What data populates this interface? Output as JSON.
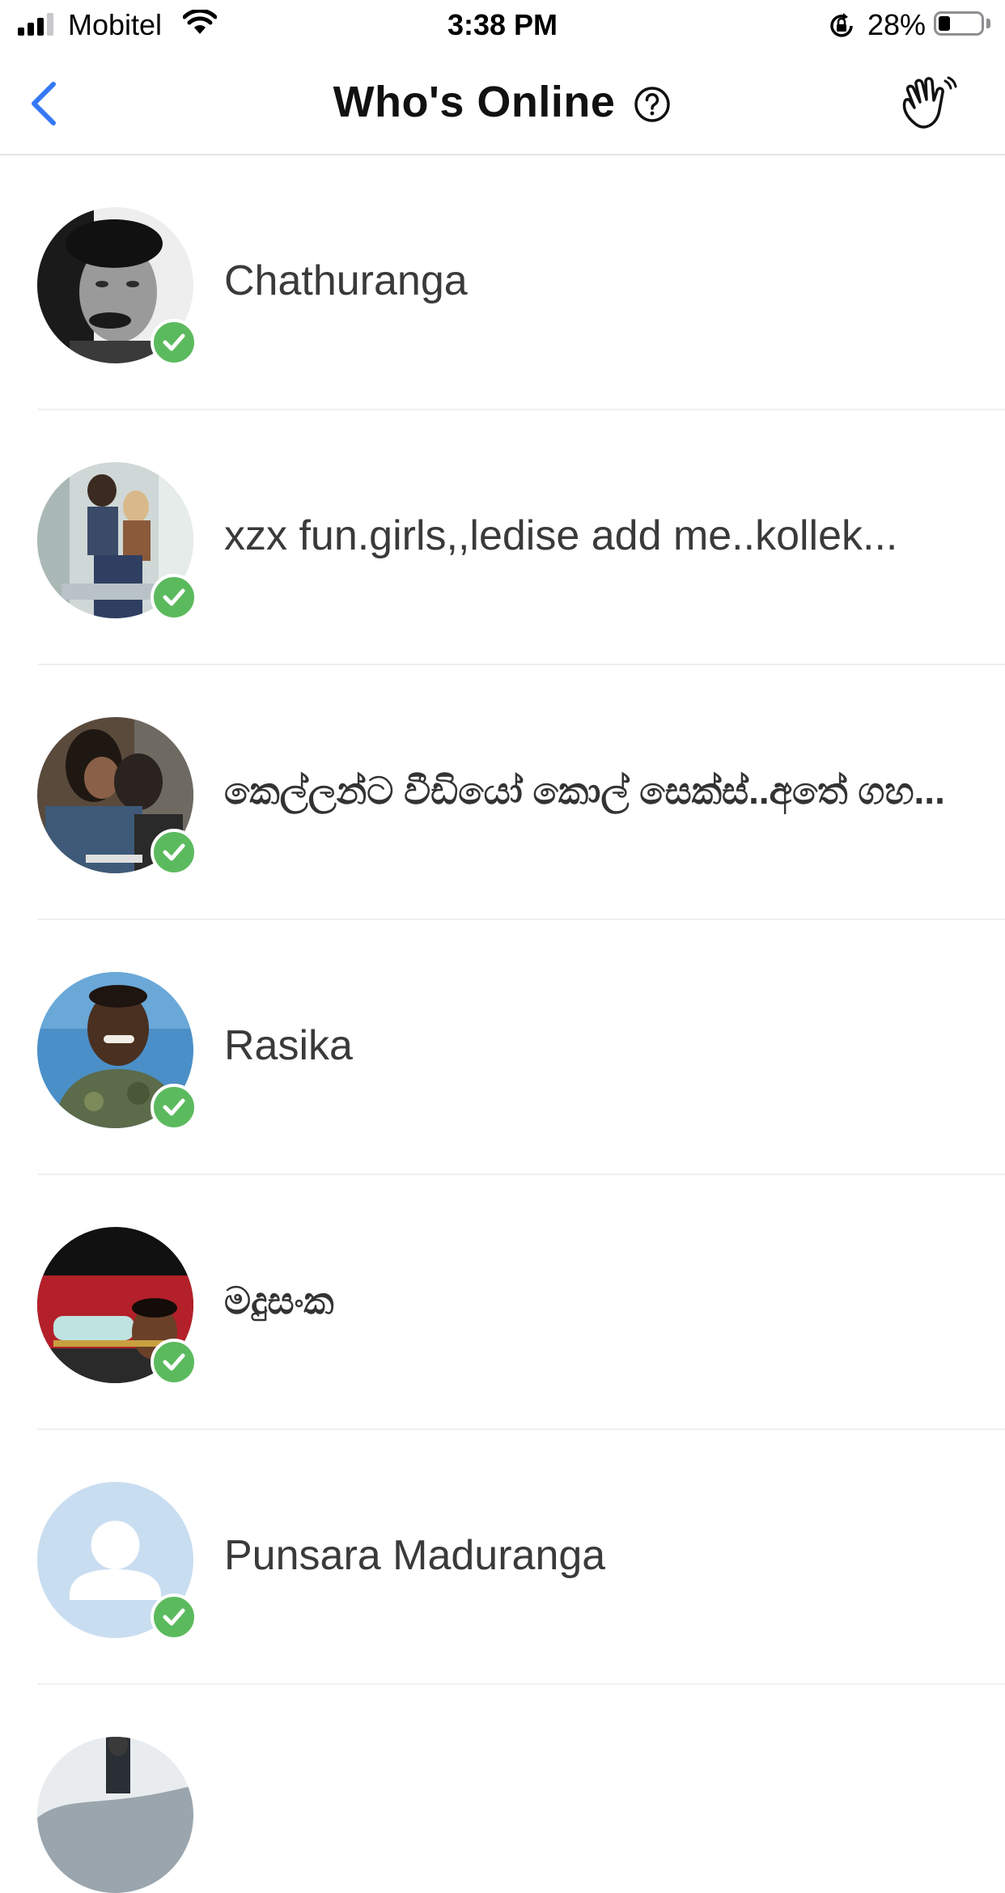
{
  "status_bar": {
    "carrier": "Mobitel",
    "time": "3:38 PM",
    "battery_percent": "28%",
    "battery_level": 0.28,
    "signal_bars": 3
  },
  "nav": {
    "title": "Who's Online",
    "back_icon": "chevron-left-icon",
    "help_icon": "question-circle-icon",
    "wave_icon": "waving-hand-icon",
    "accent_color": "#3478f6"
  },
  "online_badge_color": "#5cba5e",
  "users": [
    {
      "name": "Chathuranga",
      "online": true
    },
    {
      "name": "xzx fun.girls,,ledise add me..kollek...",
      "online": true
    },
    {
      "name": "කෙල්ලන්ට වීඩියෝ කොල් සෙක්ස්..අතේ ගහ...",
      "online": true
    },
    {
      "name": "Rasika",
      "online": true
    },
    {
      "name": "මදුසංක",
      "online": true
    },
    {
      "name": "Punsara Maduranga",
      "online": true
    },
    {
      "name": "",
      "online": true
    }
  ]
}
